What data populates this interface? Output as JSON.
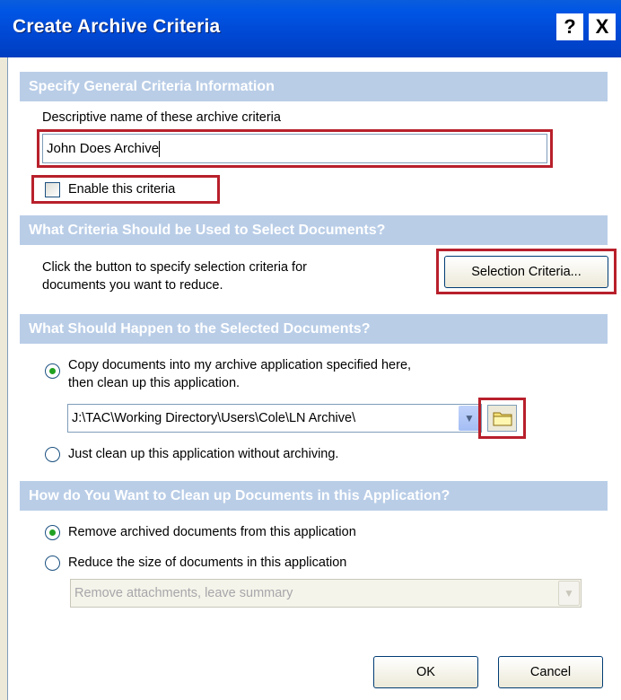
{
  "window": {
    "title": "Create Archive Criteria",
    "help_label": "?",
    "close_label": "X"
  },
  "general": {
    "header": "Specify General Criteria Information",
    "name_label": "Descriptive name of these archive criteria",
    "name_value": "John Does Archive",
    "enable_label": "Enable this criteria",
    "enable_checked": false
  },
  "selection": {
    "header": "What Criteria Should be Used to Select Documents?",
    "desc_line1": "Click the button to specify selection criteria for",
    "desc_line2": "documents you want to reduce.",
    "button_label": "Selection Criteria..."
  },
  "happen": {
    "header": "What Should Happen to the Selected Documents?",
    "copy_line1": "Copy documents into my archive application specified here,",
    "copy_line2": "then clean up this application.",
    "path_value": "J:\\TAC\\Working Directory\\Users\\Cole\\LN Archive\\",
    "cleanup_label": "Just clean up this application without archiving.",
    "selected": "copy"
  },
  "cleanup": {
    "header": "How do You Want to Clean up Documents in this Application?",
    "remove_label": "Remove archived documents from this application",
    "reduce_label": "Reduce the size of documents in this application",
    "reduce_option": "Remove attachments, leave summary",
    "selected": "remove"
  },
  "footer": {
    "ok_label": "OK",
    "cancel_label": "Cancel"
  },
  "colors": {
    "titlebar": "#0055E5",
    "section_header": "#B9CDE7",
    "highlight": "#B8202B"
  }
}
